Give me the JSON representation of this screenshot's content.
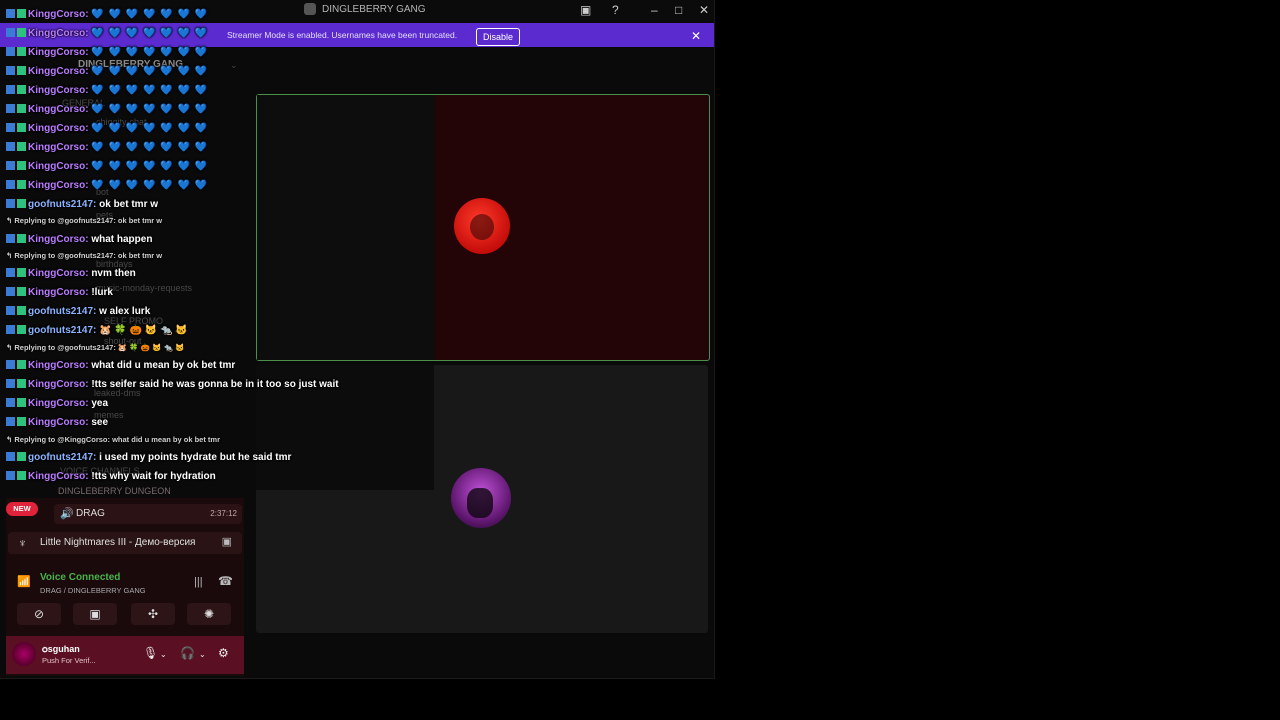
{
  "window": {
    "title": "DINGLEBERRY GANG",
    "controls": [
      "minimize",
      "maximize",
      "close"
    ]
  },
  "banner": {
    "text": "Streamer Mode is enabled. Usernames have been truncated.",
    "button": "Disable"
  },
  "sidebar": {
    "server_name": "DINGLEBERRY GANG",
    "faint_items": [
      "GENERAL",
      "chiggity-chat",
      "music-monday-requests",
      "SELF PROMO",
      "shout-out",
      "leaked-dms",
      "memes",
      "VOICE CHANNELS",
      "birthdays",
      "bot",
      "pets"
    ],
    "voice_header": "DINGLEBERRY DUNGEON"
  },
  "voice_panel": {
    "new_badge": "NEW",
    "channel_name": "DRAG",
    "channel_time": "2:37:12",
    "activity": "Little Nightmares III - Демо-версия",
    "connected_label": "Voice Connected",
    "connected_sub": "DRAG / DINGLEBERRY GANG"
  },
  "user_panel": {
    "username": "ѻsguhan",
    "status": "Push For Verif..."
  },
  "chat": [
    {
      "type": "msg",
      "user": "KinggCorso",
      "text": "💙 💙 💙 💙 💙 💙 💙",
      "hearts": true
    },
    {
      "type": "msg",
      "user": "KinggCorso",
      "text": "💙 💙 💙 💙 💙 💙 💙",
      "hearts": true
    },
    {
      "type": "msg",
      "user": "KinggCorso",
      "text": "💙 💙 💙 💙 💙 💙 💙",
      "hearts": true
    },
    {
      "type": "msg",
      "user": "KinggCorso",
      "text": "💙 💙 💙 💙 💙 💙 💙",
      "hearts": true
    },
    {
      "type": "msg",
      "user": "KinggCorso",
      "text": "💙 💙 💙 💙 💙 💙 💙",
      "hearts": true
    },
    {
      "type": "msg",
      "user": "KinggCorso",
      "text": "💙 💙 💙 💙 💙 💙 💙",
      "hearts": true
    },
    {
      "type": "msg",
      "user": "KinggCorso",
      "text": "💙 💙 💙 💙 💙 💙 💙",
      "hearts": true
    },
    {
      "type": "msg",
      "user": "KinggCorso",
      "text": "💙 💙 💙 💙 💙 💙 💙",
      "hearts": true
    },
    {
      "type": "msg",
      "user": "KinggCorso",
      "text": "💙 💙 💙 💙 💙 💙 💙",
      "hearts": true
    },
    {
      "type": "msg",
      "user": "KinggCorso",
      "text": "💙 💙 💙 💙 💙 💙 💙",
      "hearts": true
    },
    {
      "type": "msg",
      "user": "goofnuts2147",
      "text": "ok bet tmr w"
    },
    {
      "type": "reply",
      "text": "Replying to @goofnuts2147: ok bet tmr w"
    },
    {
      "type": "msg",
      "user": "KinggCorso",
      "text": "what happen"
    },
    {
      "type": "reply",
      "text": "Replying to @goofnuts2147: ok bet tmr w"
    },
    {
      "type": "msg",
      "user": "KinggCorso",
      "text": "nvm then"
    },
    {
      "type": "msg",
      "user": "KinggCorso",
      "text": "!lurk"
    },
    {
      "type": "msg",
      "user": "goofnuts2147",
      "text": "w alex lurk"
    },
    {
      "type": "msg",
      "user": "goofnuts2147",
      "text": "🐹 🍀 🎃 🐱 🐀 🐱"
    },
    {
      "type": "reply",
      "text": "Replying to @goofnuts2147: 🐹 🍀 🎃 🐱 🐀 🐱"
    },
    {
      "type": "msg",
      "user": "KinggCorso",
      "text": "what did u mean by ok bet tmr"
    },
    {
      "type": "msg",
      "user": "KinggCorso",
      "text": "!tts seifer said he was gonna be in it too so just wait"
    },
    {
      "type": "msg",
      "user": "KinggCorso",
      "text": "yea"
    },
    {
      "type": "msg",
      "user": "KinggCorso",
      "text": "see"
    },
    {
      "type": "reply",
      "text": "Replying to @KinggCorso: what did u mean by ok bet tmr"
    },
    {
      "type": "msg",
      "user": "goofnuts2147",
      "text": "i used my points hydrate but he said tmr"
    },
    {
      "type": "msg",
      "user": "KinggCorso",
      "text": "!tts why wait for hydration"
    }
  ]
}
